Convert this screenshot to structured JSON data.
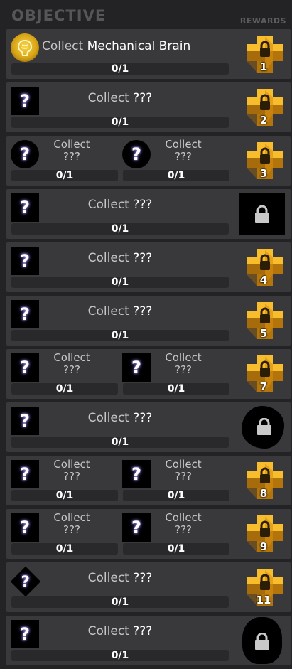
{
  "header": {
    "title": "OBJECTIVE",
    "rewards_label": "REWARDS"
  },
  "colors": {
    "reward_gold": "#e8a417",
    "background": "#232325",
    "row": "#39393c",
    "bar": "#29292b"
  },
  "rows": [
    {
      "type": "single",
      "icon": "mechanical-brain-icon",
      "prefix": "Collect",
      "item": "Mechanical Brain",
      "progress": "0/1",
      "reward": {
        "kind": "gold-box",
        "number": "1"
      }
    },
    {
      "type": "single",
      "icon": "unknown-square-icon",
      "prefix": "Collect",
      "item": "???",
      "progress": "0/1",
      "reward": {
        "kind": "gold-box",
        "number": "2"
      }
    },
    {
      "type": "double",
      "items": [
        {
          "icon": "unknown-circle-icon",
          "prefix": "Collect",
          "item": "???",
          "progress": "0/1"
        },
        {
          "icon": "unknown-circle-icon",
          "prefix": "Collect",
          "item": "???",
          "progress": "0/1"
        }
      ],
      "reward": {
        "kind": "gold-box",
        "number": "3"
      }
    },
    {
      "type": "single",
      "icon": "unknown-square-icon",
      "prefix": "Collect",
      "item": "???",
      "progress": "0/1",
      "reward": {
        "kind": "locked-square",
        "number": ""
      }
    },
    {
      "type": "single",
      "icon": "unknown-square-icon",
      "prefix": "Collect",
      "item": "???",
      "progress": "0/1",
      "reward": {
        "kind": "gold-box",
        "number": "4"
      }
    },
    {
      "type": "single",
      "icon": "unknown-square-icon",
      "prefix": "Collect",
      "item": "???",
      "progress": "0/1",
      "reward": {
        "kind": "gold-box",
        "number": "5"
      }
    },
    {
      "type": "double",
      "items": [
        {
          "icon": "unknown-square-icon",
          "prefix": "Collect",
          "item": "???",
          "progress": "0/1"
        },
        {
          "icon": "unknown-square-icon",
          "prefix": "Collect",
          "item": "???",
          "progress": "0/1"
        }
      ],
      "reward": {
        "kind": "gold-box",
        "number": "7"
      }
    },
    {
      "type": "single",
      "icon": "unknown-square-icon",
      "prefix": "Collect",
      "item": "???",
      "progress": "0/1",
      "reward": {
        "kind": "locked-splat",
        "number": ""
      }
    },
    {
      "type": "double",
      "items": [
        {
          "icon": "unknown-square-icon",
          "prefix": "Collect",
          "item": "???",
          "progress": "0/1"
        },
        {
          "icon": "unknown-square-icon",
          "prefix": "Collect",
          "item": "???",
          "progress": "0/1"
        }
      ],
      "reward": {
        "kind": "gold-box",
        "number": "8"
      }
    },
    {
      "type": "double",
      "items": [
        {
          "icon": "unknown-square-icon",
          "prefix": "Collect",
          "item": "???",
          "progress": "0/1"
        },
        {
          "icon": "unknown-square-icon",
          "prefix": "Collect",
          "item": "???",
          "progress": "0/1"
        }
      ],
      "reward": {
        "kind": "gold-box",
        "number": "9"
      }
    },
    {
      "type": "single",
      "icon": "unknown-diamond-icon",
      "prefix": "Collect",
      "item": "???",
      "progress": "0/1",
      "reward": {
        "kind": "gold-box",
        "number": "11"
      }
    },
    {
      "type": "single",
      "icon": "unknown-square-icon",
      "prefix": "Collect",
      "item": "???",
      "progress": "0/1",
      "reward": {
        "kind": "locked-blob",
        "number": ""
      }
    }
  ]
}
